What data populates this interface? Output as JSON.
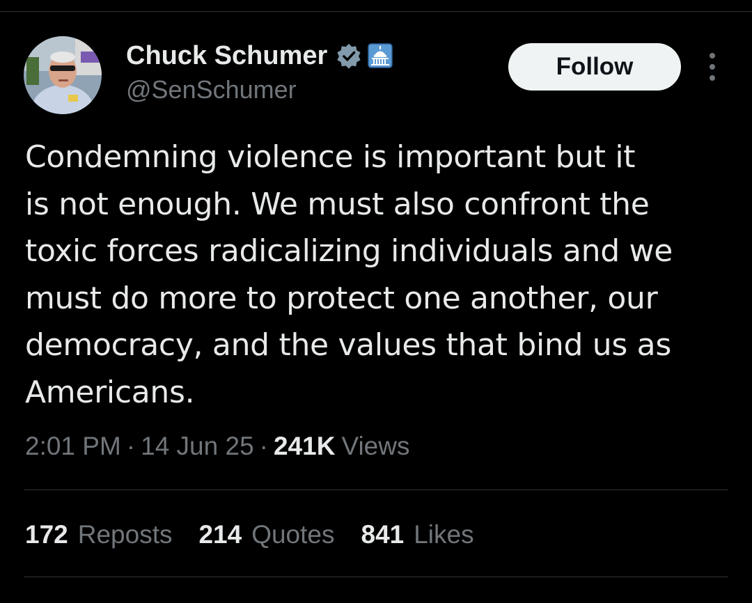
{
  "author": {
    "display_name": "Chuck Schumer",
    "handle": "@SenSchumer",
    "verified_badge": "verified-badge-icon",
    "affiliation_badge": "capitol-building-icon"
  },
  "actions": {
    "follow_label": "Follow",
    "more_icon": "more-vertical-icon"
  },
  "tweet": {
    "text": "Condemning violence is important but it\nis not enough. We must also confront the\ntoxic forces radicalizing individuals and we\nmust do more to protect one another, our\ndemocracy, and the values that bind us as\nAmericans.",
    "time": "2:01 PM",
    "separator": "·",
    "date": "14 Jun 25",
    "views_count": "241K",
    "views_label": "Views"
  },
  "stats": [
    {
      "count": "172",
      "label": "Reposts"
    },
    {
      "count": "214",
      "label": "Quotes"
    },
    {
      "count": "841",
      "label": "Likes"
    }
  ],
  "colors": {
    "background": "#000000",
    "primary_text": "#e7e9ea",
    "secondary_text": "#71767b",
    "divider": "#2f3336",
    "follow_button_bg": "#eff3f4",
    "verified_badge": "#829aab"
  }
}
